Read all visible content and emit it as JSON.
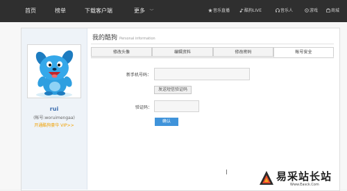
{
  "nav": {
    "left": [
      {
        "label": "首页"
      },
      {
        "label": "榜单"
      },
      {
        "label": "下载客户端"
      },
      {
        "label": "更多"
      }
    ],
    "right": [
      {
        "label": "音乐直播",
        "icon": "star-icon"
      },
      {
        "label": "酷狗LIVE",
        "icon": "music-note-icon"
      },
      {
        "label": "音乐人",
        "icon": "headphones-icon"
      },
      {
        "label": "游戏",
        "icon": "gamepad-icon"
      },
      {
        "label": "商城",
        "icon": "shopping-bag-icon"
      }
    ]
  },
  "sidebar": {
    "username": "rui",
    "account": "(帐号:woruimengaa)",
    "vip": "开通酷狗豪华 VIP>>"
  },
  "page": {
    "title": "我的酷狗",
    "subtitle": "Personal information"
  },
  "tabs": [
    {
      "label": "修改头像",
      "active": false
    },
    {
      "label": "编辑资料",
      "active": false
    },
    {
      "label": "修改密码",
      "active": false
    },
    {
      "label": "帐号安全",
      "active": true
    }
  ],
  "form": {
    "phone_label": "新手机号码：",
    "phone_value": "",
    "send_code": "发送短信验证码",
    "code_label": "验证码：",
    "code_value": "",
    "confirm": "确认"
  },
  "watermark": {
    "text": "易采站长站",
    "url": "Www.Easck.Com"
  },
  "colors": {
    "nav_bg": "#2f2f2f",
    "accent": "#3f93da",
    "vip": "#f0a000",
    "username": "#3c6dae"
  }
}
